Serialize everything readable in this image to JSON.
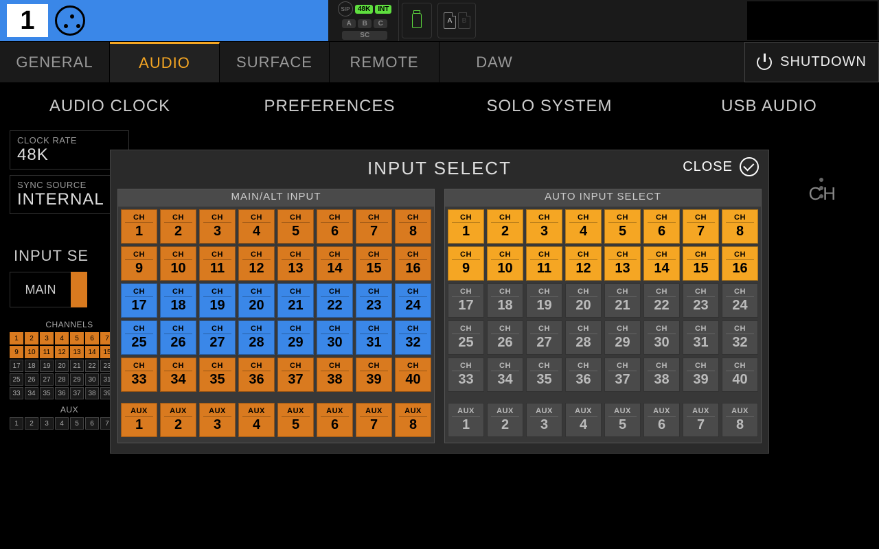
{
  "top": {
    "channel": "1",
    "sip": "SIP",
    "rate": "48K",
    "sync": "INT",
    "a": "A",
    "b": "B",
    "c": "C",
    "sc": "SC",
    "cardA": "A",
    "cardB": "B"
  },
  "tabs": {
    "general": "GENERAL",
    "audio": "AUDIO",
    "surface": "SURFACE",
    "remote": "REMOTE",
    "daw": "DAW"
  },
  "shutdown": "SHUTDOWN",
  "subtabs": {
    "clock": "AUDIO CLOCK",
    "prefs": "PREFERENCES",
    "solo": "SOLO SYSTEM",
    "usb": "USB AUDIO"
  },
  "clock": {
    "rate_label": "CLOCK RATE",
    "rate": "48K",
    "sync_label": "SYNC SOURCE",
    "sync": "INTERNAL"
  },
  "section_input_select": "INPUT SE",
  "main_btn": "MAIN",
  "behind_text": "CH",
  "bg_grid": {
    "channels_label": "CHANNELS",
    "aux_label": "AUX"
  },
  "modal": {
    "title": "INPUT SELECT",
    "close": "CLOSE",
    "left_title": "MAIN/ALT INPUT",
    "right_title": "AUTO INPUT SELECT",
    "ch_label": "CH",
    "aux_label": "AUX",
    "left_colors": [
      "orange",
      "orange",
      "blue",
      "blue",
      "orange"
    ],
    "right_colors": [
      "yellow",
      "yellow",
      "grey",
      "grey",
      "grey"
    ],
    "left_aux": "orange",
    "right_aux": "grey"
  }
}
